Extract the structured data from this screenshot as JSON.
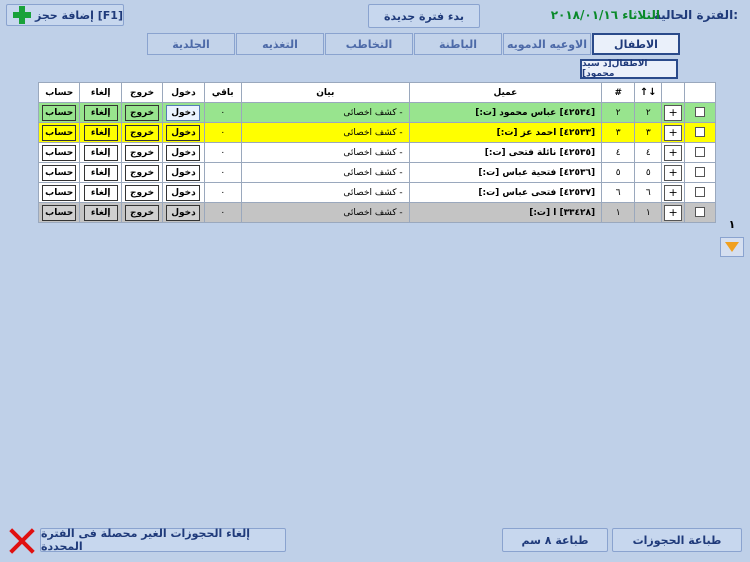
{
  "header": {
    "period_label": "الفترة الحالية:",
    "period_value": "الثلاثاء ٢٠١٨/٠١/١٦",
    "new_period_button": "بدء فترة جديدة",
    "add_booking_button": "إضافة حجز [F1]"
  },
  "tabs": [
    {
      "label": "الاطفال",
      "active": true
    },
    {
      "label": "الاوعيه الدمويه",
      "active": false
    },
    {
      "label": "الباطنة",
      "active": false
    },
    {
      "label": "التخاطب",
      "active": false
    },
    {
      "label": "التغذيه",
      "active": false
    },
    {
      "label": "الجلدية",
      "active": false
    }
  ],
  "doctor_badge": "الاطفال[د سيد محمود]",
  "table": {
    "columns": {
      "client": "عميل",
      "number": "#",
      "statement": "بيان",
      "remaining": "باقي",
      "enter": "دخول",
      "exit": "خروج",
      "cancel": "إلغاء",
      "account": "حساب"
    },
    "rows": [
      {
        "order": "٢",
        "number": "٢",
        "client": "[٤٢٥٣٤] عباس محمود [ت:]",
        "statement": "- كشف اخصائى",
        "remaining": "٠",
        "enter": "دخول",
        "exit": "خروج",
        "cancel": "إلغاء",
        "account": "حساب",
        "color": "green"
      },
      {
        "order": "٣",
        "number": "٣",
        "client": "[٤٢٥٣٣] احمد عز [ت:]",
        "statement": "- كشف اخصائى",
        "remaining": "٠",
        "enter": "دخول",
        "exit": "خروج",
        "cancel": "إلغاء",
        "account": "حساب",
        "color": "yellow"
      },
      {
        "order": "٤",
        "number": "٤",
        "client": "[٤٢٥٣٥] نائلة فتحى [ت:]",
        "statement": "- كشف اخصائى",
        "remaining": "٠",
        "enter": "دخول",
        "exit": "خروج",
        "cancel": "إلغاء",
        "account": "حساب",
        "color": "white"
      },
      {
        "order": "٥",
        "number": "٥",
        "client": "[٤٢٥٣٦] فتحية عباس [ت:]",
        "statement": "- كشف اخصائى",
        "remaining": "٠",
        "enter": "دخول",
        "exit": "خروج",
        "cancel": "إلغاء",
        "account": "حساب",
        "color": "white"
      },
      {
        "order": "٦",
        "number": "٦",
        "client": "[٤٢٥٣٧] فتحى عباس [ت:]",
        "statement": "- كشف اخصائى",
        "remaining": "٠",
        "enter": "دخول",
        "exit": "خروج",
        "cancel": "إلغاء",
        "account": "حساب",
        "color": "white"
      },
      {
        "order": "١",
        "number": "١",
        "client": "[٣٣٤٢٨] ا [ت:]",
        "statement": "- كشف اخصائى",
        "remaining": "٠",
        "enter": "دخول",
        "exit": "خروج",
        "cancel": "إلغاء",
        "account": "حساب",
        "color": "gray"
      }
    ]
  },
  "pager": {
    "page": "١"
  },
  "footer": {
    "print_bookings": "طباعة الحجوزات",
    "print_8cm": "طباعة ٨ سم",
    "cancel_unpaid": "إلغاء الحجوزات الغير محصلة فى الفترة المحددة"
  },
  "colors": {
    "green": "#98e48e",
    "yellow": "#ffff00",
    "gray": "#c4c4c4",
    "accent": "#1f3a7a"
  }
}
